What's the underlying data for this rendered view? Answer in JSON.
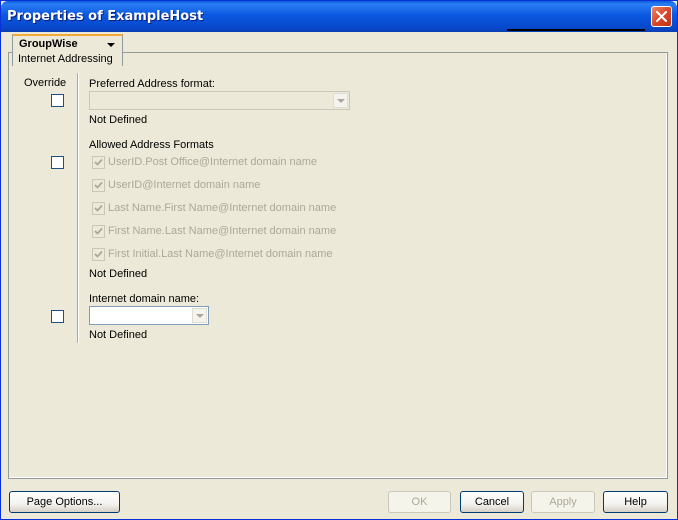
{
  "window": {
    "title": "Properties of ExampleHost"
  },
  "tab": {
    "title": "GroupWise",
    "subtitle": "Internet Addressing"
  },
  "columns": {
    "override": "Override"
  },
  "preferred": {
    "label": "Preferred Address format:",
    "status": "Not Defined"
  },
  "allowed": {
    "label": "Allowed Address Formats",
    "status": "Not Defined",
    "options": [
      "UserID.Post Office@Internet domain name",
      "UserID@Internet domain name",
      "Last Name.First Name@Internet domain name",
      "First Name.Last Name@Internet domain name",
      "First Initial.Last Name@Internet domain name"
    ]
  },
  "domain": {
    "label": "Internet domain name:",
    "status": "Not Defined"
  },
  "buttons": {
    "page_options": "Page Options...",
    "ok": "OK",
    "cancel": "Cancel",
    "apply": "Apply",
    "help": "Help"
  },
  "colors": {
    "title_bar": "#0a5bd8",
    "face": "#ece9d8",
    "disabled_text": "#aca899",
    "tab_highlight": "#f2a93b"
  }
}
